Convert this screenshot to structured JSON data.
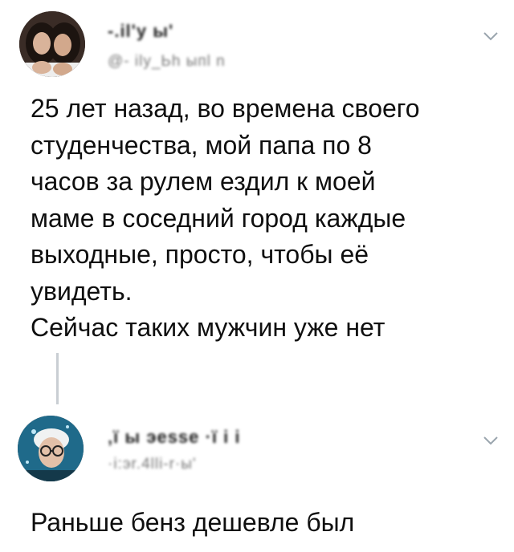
{
  "tweet1": {
    "author_name": "-.іl'у ы'",
    "author_handle": "@- іlу_Ьh ыпl n",
    "menu_icon": "chevron-down-icon",
    "text": "25 лет назад, во времена своего\nстуденчества, мой папа по 8\nчасов за рулем ездил к моей\nмаме в соседний город каждые\nвыходные, просто, чтобы её\nувидеть.\nСейчас таких мужчин уже нет"
  },
  "tweet2": {
    "author_name": "‚ї ы эesse ·ї і і",
    "author_handle": "·і:эr.4lli-r·ы'",
    "menu_icon": "chevron-down-icon",
    "text": "Раньше бенз дешевле был"
  },
  "colors": {
    "text": "#0f0f0f",
    "muted": "#777777",
    "thread_line": "#c9ced3",
    "chevron": "#9aa5ae"
  }
}
